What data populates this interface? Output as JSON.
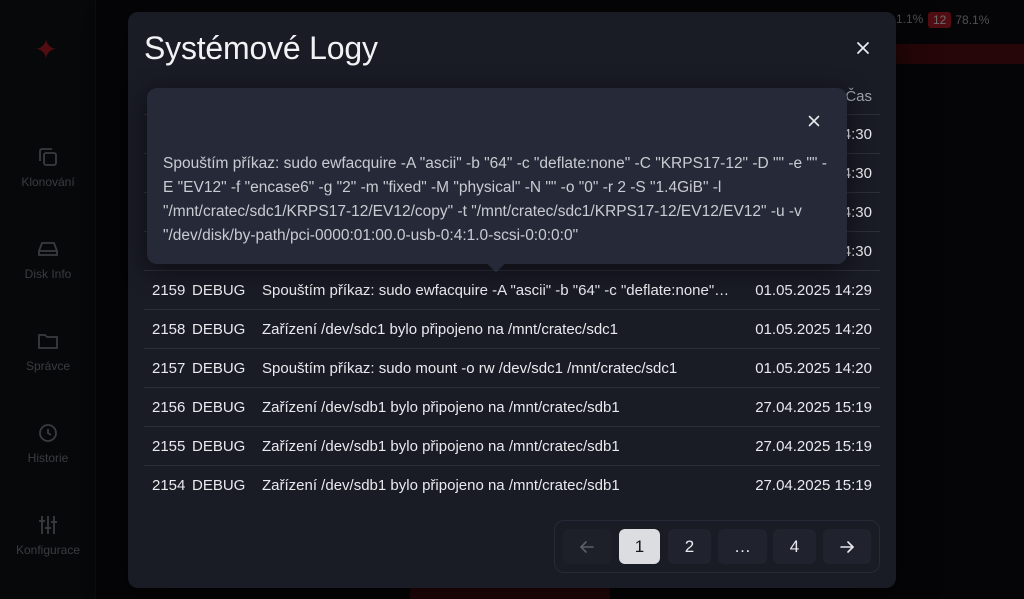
{
  "background": {
    "nav": [
      {
        "label": "Klonování",
        "icon": "copy-icon"
      },
      {
        "label": "Disk Info",
        "icon": "disk-icon"
      },
      {
        "label": "Správce",
        "icon": "folder-icon"
      },
      {
        "label": "Historie",
        "icon": "history-icon"
      },
      {
        "label": "Konfigurace",
        "icon": "sliders-icon"
      }
    ],
    "stats": {
      "cpu": "1.1%",
      "mem_badge": "12",
      "mem": "78.1%"
    }
  },
  "modal": {
    "title": "Systémové Logy",
    "columns": {
      "time": "Čas"
    },
    "rows": [
      {
        "id": "",
        "level": "",
        "message": "",
        "time": "4:30"
      },
      {
        "id": "",
        "level": "",
        "message": "",
        "time": "4:30"
      },
      {
        "id": "",
        "level": "",
        "message": "",
        "time": "4:30"
      },
      {
        "id": "",
        "level": "",
        "message": "",
        "time": "4:30"
      },
      {
        "id": "2159",
        "level": "DEBUG",
        "message": "Spouštím příkaz: sudo ewfacquire -A \"ascii\" -b \"64\" -c \"deflate:none\" -C...",
        "time": "01.05.2025 14:29"
      },
      {
        "id": "2158",
        "level": "DEBUG",
        "message": "Zařízení /dev/sdc1 bylo připojeno na /mnt/cratec/sdc1",
        "time": "01.05.2025 14:20"
      },
      {
        "id": "2157",
        "level": "DEBUG",
        "message": "Spouštím příkaz: sudo mount -o rw /dev/sdc1 /mnt/cratec/sdc1",
        "time": "01.05.2025 14:20"
      },
      {
        "id": "2156",
        "level": "DEBUG",
        "message": "Zařízení /dev/sdb1 bylo připojeno na /mnt/cratec/sdb1",
        "time": "27.04.2025 15:19"
      },
      {
        "id": "2155",
        "level": "DEBUG",
        "message": "Zařízení /dev/sdb1 bylo připojeno na /mnt/cratec/sdb1",
        "time": "27.04.2025 15:19"
      },
      {
        "id": "2154",
        "level": "DEBUG",
        "message": "Zařízení /dev/sdb1 bylo připojeno na /mnt/cratec/sdb1",
        "time": "27.04.2025 15:19"
      }
    ],
    "tooltip": {
      "text": "Spouštím příkaz: sudo ewfacquire -A \"ascii\" -b \"64\" -c \"deflate:none\" -C \"KRPS17-12\" -D \"\" -e \"\" -E \"EV12\" -f \"encase6\" -g \"2\" -m \"fixed\" -M \"physical\" -N \"\" -o \"0\" -r 2 -S \"1.4GiB\" -l \"/mnt/cratec/sdc1/KRPS17-12/EV12/copy\" -t \"/mnt/cratec/sdc1/KRPS17-12/EV12/EV12\" -u -v \"/dev/disk/by-path/pci-0000:01:00.0-usb-0:4:1.0-scsi-0:0:0:0\""
    },
    "pagination": {
      "prev": "←",
      "pages": [
        "1",
        "2",
        "…",
        "4"
      ],
      "next": "→",
      "current": "1"
    }
  }
}
